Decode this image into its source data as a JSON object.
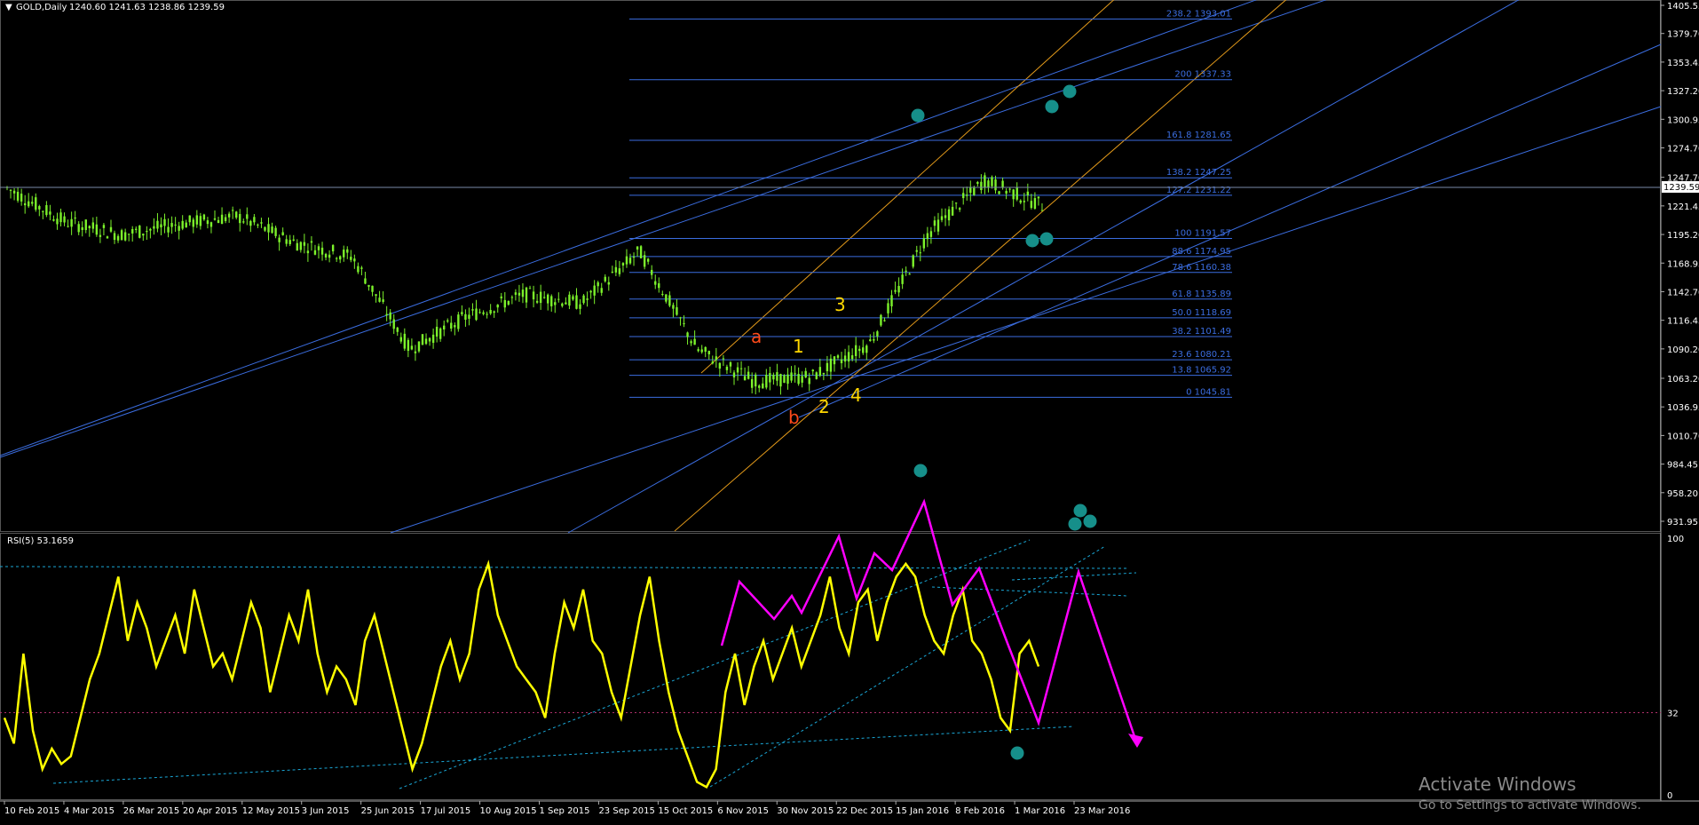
{
  "header": {
    "symbol": "GOLD,Daily",
    "ohlc": "1240.60 1241.63 1238.86 1239.59"
  },
  "current_price_label": "1239.59",
  "rsi_header": "RSI(5) 53.1659",
  "watermark": {
    "title": "Activate Windows",
    "subtitle": "Go to Settings to activate Windows."
  },
  "colors": {
    "background": "#000000",
    "candle": "#7cf22b",
    "channel": "#3b6de0",
    "fib": "#3b6de0",
    "orange": "#e39a1a",
    "rsi": "#ffff00",
    "magenta": "#ff00ff",
    "cyan_dotted": "#1aa7d6",
    "teal_marker": "#168f8a",
    "wave_red": "#ff4a1a",
    "wave_yellow": "#ffd700"
  },
  "chart_data": [
    {
      "type": "line",
      "title": "GOLD,Daily",
      "y_axis_ticks": [
        "1405.55",
        "1379.70",
        "1353.45",
        "1327.20",
        "1300.95",
        "1274.70",
        "1247.70",
        "1221.45",
        "1195.20",
        "1168.95",
        "1142.70",
        "1116.45",
        "1090.20",
        "1063.20",
        "1036.95",
        "1010.70",
        "984.45",
        "958.20",
        "931.95"
      ],
      "ylim": [
        931.95,
        1405.55
      ],
      "x_axis_ticks": [
        "10 Feb 2015",
        "4 Mar 2015",
        "26 Mar 2015",
        "20 Apr 2015",
        "12 May 2015",
        "3 Jun 2015",
        "25 Jun 2015",
        "17 Jul 2015",
        "10 Aug 2015",
        "1 Sep 2015",
        "23 Sep 2015",
        "15 Oct 2015",
        "6 Nov 2015",
        "30 Nov 2015",
        "22 Dec 2015",
        "15 Jan 2016",
        "8 Feb 2016",
        "1 Mar 2016",
        "23 Mar 2016"
      ],
      "price_path": {
        "x": [
          "10 Feb 2015",
          "4 Mar 2015",
          "26 Mar 2015",
          "20 Apr 2015",
          "12 May 2015",
          "3 Jun 2015",
          "25 Jun 2015",
          "17 Jul 2015",
          "10 Aug 2015",
          "1 Sep 2015",
          "23 Sep 2015",
          "15 Oct 2015",
          "6 Nov 2015",
          "30 Nov 2015",
          "22 Dec 2015",
          "15 Jan 2016",
          "8 Feb 2016",
          "1 Mar 2016",
          "23 Mar 2016"
        ],
        "y": [
          1238,
          1207,
          1195,
          1205,
          1212,
          1188,
          1175,
          1090,
          1120,
          1140,
          1132,
          1180,
          1090,
          1060,
          1065,
          1095,
          1195,
          1245,
          1222
        ]
      },
      "fib_levels": [
        {
          "label": "238.2 1393.01",
          "value": 1393.01
        },
        {
          "label": "200 1337.33",
          "value": 1337.33
        },
        {
          "label": "161.8 1281.65",
          "value": 1281.65
        },
        {
          "label": "138.2 1247.25",
          "value": 1247.25
        },
        {
          "label": "127.2 1231.22",
          "value": 1231.22
        },
        {
          "label": "100 1191.57",
          "value": 1191.57
        },
        {
          "label": "88.6 1174.95",
          "value": 1174.95
        },
        {
          "label": "78.6 1160.38",
          "value": 1160.38
        },
        {
          "label": "61.8 1135.89",
          "value": 1135.89
        },
        {
          "label": "50.0 1118.69",
          "value": 1118.69
        },
        {
          "label": "38.2 1101.49",
          "value": 1101.49
        },
        {
          "label": "23.6 1080.21",
          "value": 1080.21
        },
        {
          "label": "13.8 1065.92",
          "value": 1065.92
        },
        {
          "label": "0 1045.81",
          "value": 1045.81
        }
      ],
      "wave_labels": [
        {
          "text": "a",
          "color": "red"
        },
        {
          "text": "b",
          "color": "red"
        },
        {
          "text": "1",
          "color": "yellow"
        },
        {
          "text": "2",
          "color": "yellow"
        },
        {
          "text": "3",
          "color": "yellow"
        },
        {
          "text": "4",
          "color": "yellow"
        }
      ]
    },
    {
      "type": "line",
      "title": "RSI(5) 53.1659",
      "ylim": [
        0,
        100
      ],
      "y_axis_ticks": [
        "100",
        "32",
        "0"
      ],
      "level": 32,
      "values": [
        30,
        20,
        55,
        25,
        10,
        18,
        12,
        15,
        30,
        45,
        55,
        70,
        85,
        60,
        75,
        65,
        50,
        60,
        70,
        55,
        80,
        65,
        50,
        55,
        45,
        60,
        75,
        65,
        40,
        55,
        70,
        60,
        80,
        55,
        40,
        50,
        45,
        35,
        60,
        70,
        55,
        40,
        25,
        10,
        20,
        35,
        50,
        60,
        45,
        55,
        80,
        90,
        70,
        60,
        50,
        45,
        40,
        30,
        55,
        75,
        65,
        80,
        60,
        55,
        40,
        30,
        50,
        70,
        85,
        60,
        40,
        25,
        15,
        5,
        3,
        10,
        40,
        55,
        35,
        50,
        60,
        45,
        55,
        65,
        50,
        60,
        70,
        85,
        65,
        55,
        75,
        80,
        60,
        75,
        85,
        90,
        85,
        70,
        60,
        55,
        70,
        80,
        60,
        55,
        45,
        30,
        25,
        55,
        60,
        50
      ]
    }
  ]
}
